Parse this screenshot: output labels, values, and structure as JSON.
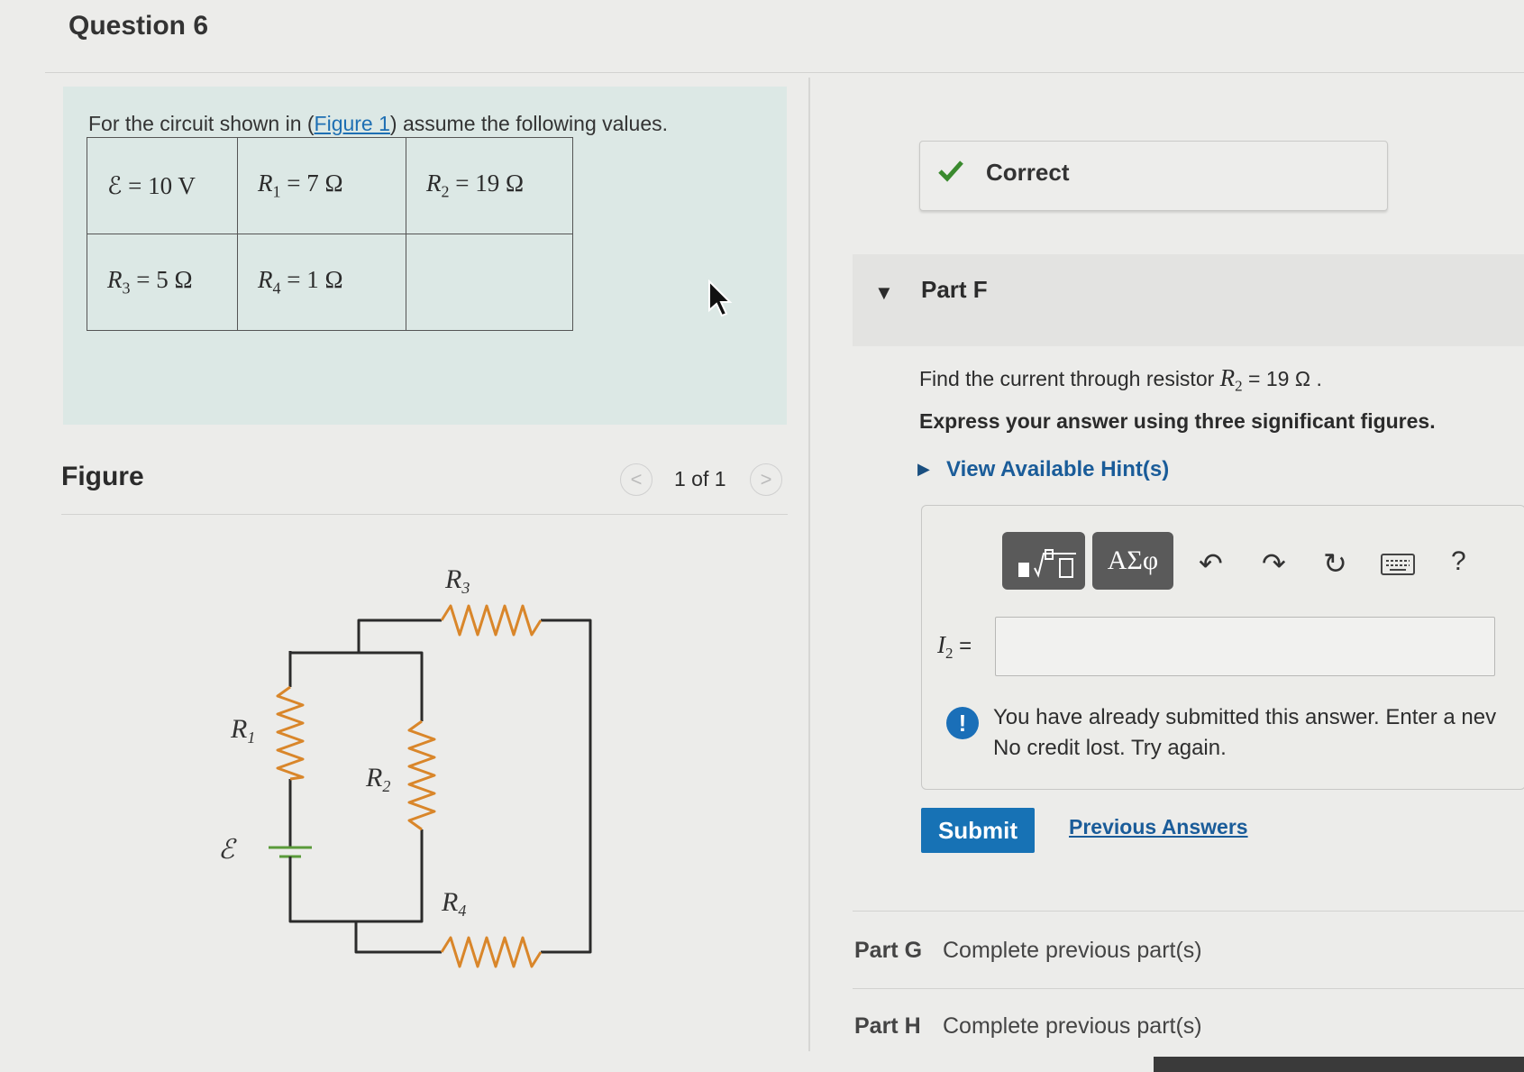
{
  "question": {
    "title": "Question 6"
  },
  "problem": {
    "intro_before": "For the circuit shown in (",
    "intro_link": "Figure 1",
    "intro_after": ") assume the following values.",
    "values": {
      "emf": "ℰ = 10 V",
      "r1": {
        "sym": "R",
        "sub": "1",
        "val": " = 7 Ω"
      },
      "r2": {
        "sym": "R",
        "sub": "2",
        "val": " = 19 Ω"
      },
      "r3": {
        "sym": "R",
        "sub": "3",
        "val": " = 5 Ω"
      },
      "r4": {
        "sym": "R",
        "sub": "4",
        "val": " = 1 Ω"
      }
    }
  },
  "figure": {
    "label": "Figure",
    "pager": "1 of 1",
    "prev_glyph": "<",
    "next_glyph": ">",
    "circuit_labels": {
      "r1": {
        "sym": "R",
        "sub": "1"
      },
      "r2": {
        "sym": "R",
        "sub": "2"
      },
      "r3": {
        "sym": "R",
        "sub": "3"
      },
      "r4": {
        "sym": "R",
        "sub": "4"
      },
      "emf": "ℰ"
    },
    "wire_color": "#2b2b2b",
    "resistor_color": "#d9862a",
    "battery_color": "#5a9a3a"
  },
  "status": {
    "correct_label": "Correct",
    "check_color": "#3a8a2e"
  },
  "part_f": {
    "label": "Part F",
    "question_before": "Find the current through resistor ",
    "question_sym": "R",
    "question_sub": "2",
    "question_after": " = 19 Ω .",
    "instruction": "Express your answer using three significant figures.",
    "hint_link": "View Available Hint(s)",
    "toolbar": {
      "greek_label": "ΑΣφ",
      "help_label": "?"
    },
    "answer": {
      "sym": "I",
      "sub": "2",
      "eq": " =",
      "value": ""
    },
    "warning_line1": "You have already submitted this answer. Enter a nev",
    "warning_line2": "No credit lost. Try again.",
    "submit_label": "Submit",
    "previous_answers_label": "Previous Answers"
  },
  "parts": [
    {
      "name": "Part G",
      "status": "Complete previous part(s)"
    },
    {
      "name": "Part H",
      "status": "Complete previous part(s)"
    }
  ],
  "colors": {
    "link": "#1a5c99",
    "submit": "#1772b5",
    "info_icon": "#1a6fb8"
  }
}
